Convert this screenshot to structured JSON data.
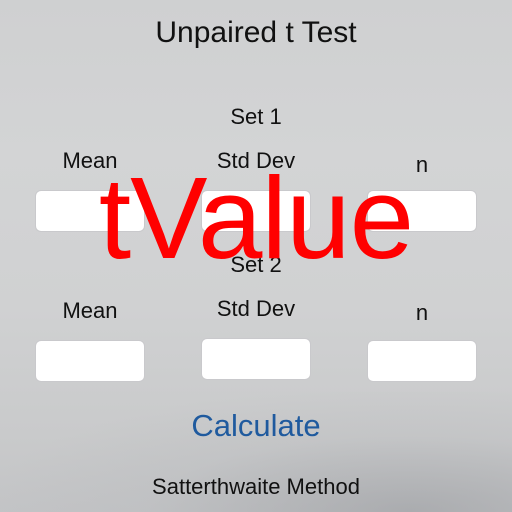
{
  "app": {
    "title": "Unpaired t Test"
  },
  "set1": {
    "label": "Set 1",
    "mean_label": "Mean",
    "std_label": "Std Dev",
    "n_label": "n",
    "mean_value": "",
    "std_value": "",
    "n_value": ""
  },
  "set2": {
    "label": "Set 2",
    "mean_label": "Mean",
    "std_label": "Std Dev",
    "n_label": "n",
    "mean_value": "",
    "std_value": "",
    "n_value": ""
  },
  "actions": {
    "calculate_label": "Calculate"
  },
  "footer": {
    "method_label": "Satterthwaite Method"
  },
  "overlay": {
    "text": "tValue"
  },
  "colors": {
    "accent": "#1f5a9e",
    "overlay": "#ff0000"
  }
}
